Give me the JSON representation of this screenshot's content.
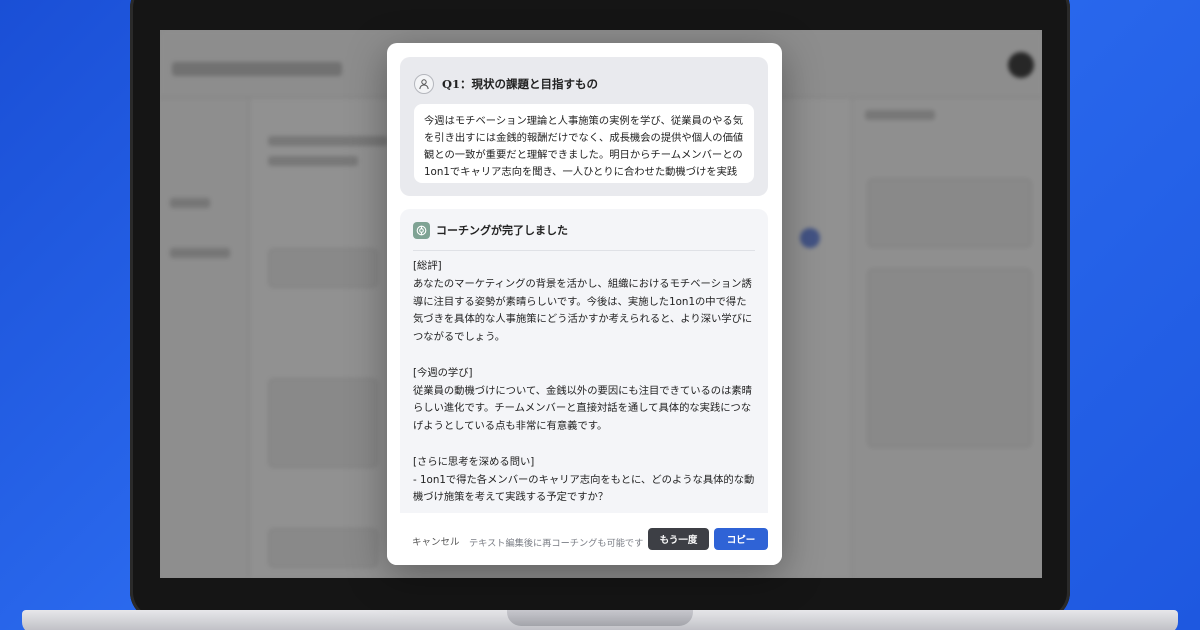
{
  "question": {
    "title": "Q1：現状の課題と目指すもの",
    "answer": "今週はモチベーション理論と人事施策の実例を学び、従業員のやる気を引き出すには金銭的報酬だけでなく、成長機会の提供や個人の価値観との一致が重要だと理解できました。明日からチームメンバーとの1on1でキャリア志向を聞き、一人ひとりに合わせた動機づけを実践していきます。"
  },
  "result": {
    "title": "コーチングが完了しました",
    "body": "[総評]\nあなたのマーケティングの背景を活かし、組織におけるモチベーション誘導に注目する姿勢が素晴らしいです。今後は、実施した1on1の中で得た気づきを具体的な人事施策にどう活かすか考えられると、より深い学びにつながるでしょう。\n\n[今週の学び]\n従業員の動機づけについて、金銭以外の要因にも注目できているのは素晴らしい進化です。チームメンバーと直接対話を通して具体的な実践につなげようとしている点も非常に有意義です。\n\n[さらに思考を深める問い]\n- 1on1で得た各メンバーのキャリア志向をもとに、どのような具体的な動機づけ施策を考えて実践する予定ですか？"
  },
  "footer": {
    "cancel_label": "キャンセル",
    "hint": "テキスト編集後に再コーチングも可能です",
    "again_label": "もう一度",
    "copy_label": "コピー"
  },
  "colors": {
    "background": "#1e58e0",
    "primary_button": "#2f63d6",
    "secondary_button": "#3d3f45"
  },
  "icons": {
    "question": "user-icon",
    "result": "assistant-logo-icon"
  }
}
